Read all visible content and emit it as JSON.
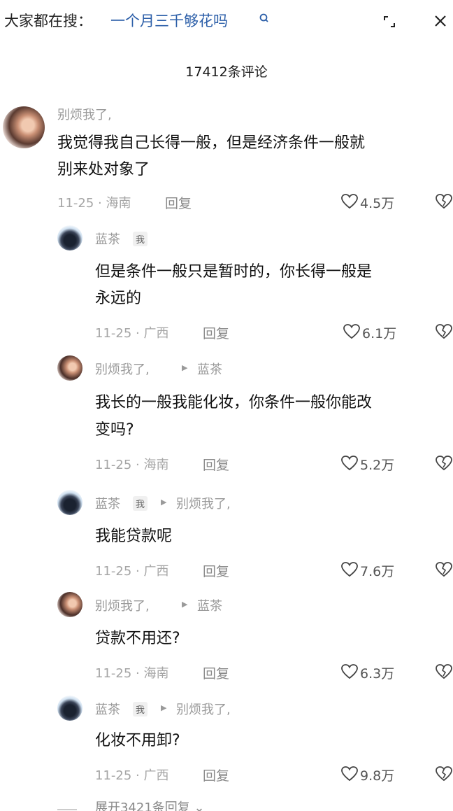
{
  "search": {
    "prefix": "大家都在搜：",
    "query": "一个月三千够花吗"
  },
  "header": {
    "comment_count": "17412条评论"
  },
  "comments": [
    {
      "author": "别烦我了,",
      "text_lines": [
        "我觉得我自己长得一般，但是经济条件一般就",
        "别来处对象了"
      ],
      "date_loc": "11-25 · 海南",
      "reply": "回复",
      "likes": "4.5万"
    },
    {
      "author": "蓝茶",
      "me_tag": "我",
      "text_lines": [
        "但是条件一般只是暂时的，你长得一般是",
        "永远的"
      ],
      "date_loc": "11-25 · 广西",
      "reply": "回复",
      "likes": "6.1万"
    },
    {
      "author": "别烦我了,",
      "reply_to": "蓝茶",
      "text_lines": [
        "我长的一般我能化妆，你条件一般你能改",
        "变吗?"
      ],
      "date_loc": "11-25 · 海南",
      "reply": "回复",
      "likes": "5.2万"
    },
    {
      "author": "蓝茶",
      "me_tag": "我",
      "reply_to": "别烦我了,",
      "text_lines": [
        "我能贷款呢"
      ],
      "date_loc": "11-25 · 广西",
      "reply": "回复",
      "likes": "7.6万"
    },
    {
      "author": "别烦我了,",
      "reply_to": "蓝茶",
      "text_lines": [
        "贷款不用还?"
      ],
      "date_loc": "11-25 · 海南",
      "reply": "回复",
      "likes": "6.3万"
    },
    {
      "author": "蓝茶",
      "me_tag": "我",
      "reply_to": "别烦我了,",
      "text_lines": [
        "化妆不用卸?"
      ],
      "date_loc": "11-25 · 广西",
      "reply": "回复",
      "likes": "9.8万"
    }
  ],
  "footer": {
    "expand_replies": "展开3421条回复 ⌄"
  },
  "colors": {
    "search_query": "#2b5ea8",
    "meta": "#a5a5a5"
  },
  "icons": [
    "search-icon",
    "expand-icon",
    "close-icon",
    "heart-icon",
    "dislike-icon"
  ]
}
